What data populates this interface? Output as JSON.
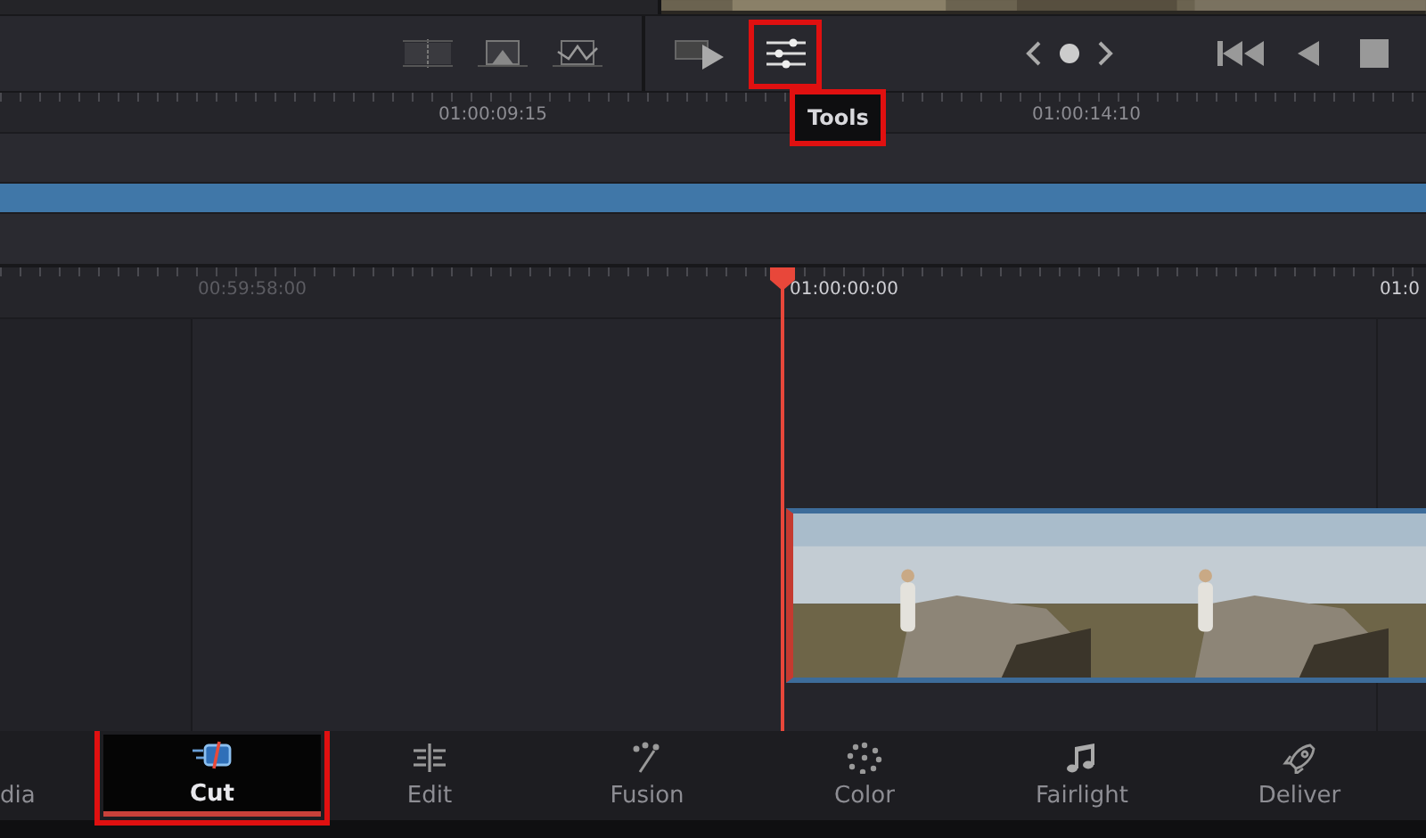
{
  "viewer_toolbar": {
    "tools_button": {
      "highlighted": true
    },
    "tooltip": {
      "text": "Tools",
      "highlighted": true
    }
  },
  "upper_timeline": {
    "timecodes": [
      "01:00:09:15",
      "01:00:14:10"
    ]
  },
  "lower_timeline": {
    "timecodes": [
      "00:59:58:00",
      "01:00:00:00",
      "01:0"
    ]
  },
  "page_tabs": [
    {
      "label": "dia",
      "kind": "media",
      "selected": false,
      "highlighted": false
    },
    {
      "label": "Cut",
      "kind": "cut",
      "selected": true,
      "highlighted": true
    },
    {
      "label": "Edit",
      "kind": "edit",
      "selected": false,
      "highlighted": false
    },
    {
      "label": "Fusion",
      "kind": "fusion",
      "selected": false,
      "highlighted": false
    },
    {
      "label": "Color",
      "kind": "color",
      "selected": false,
      "highlighted": false
    },
    {
      "label": "Fairlight",
      "kind": "fairlight",
      "selected": false,
      "highlighted": false
    },
    {
      "label": "Deliver",
      "kind": "deliver",
      "selected": false,
      "highlighted": false
    }
  ]
}
